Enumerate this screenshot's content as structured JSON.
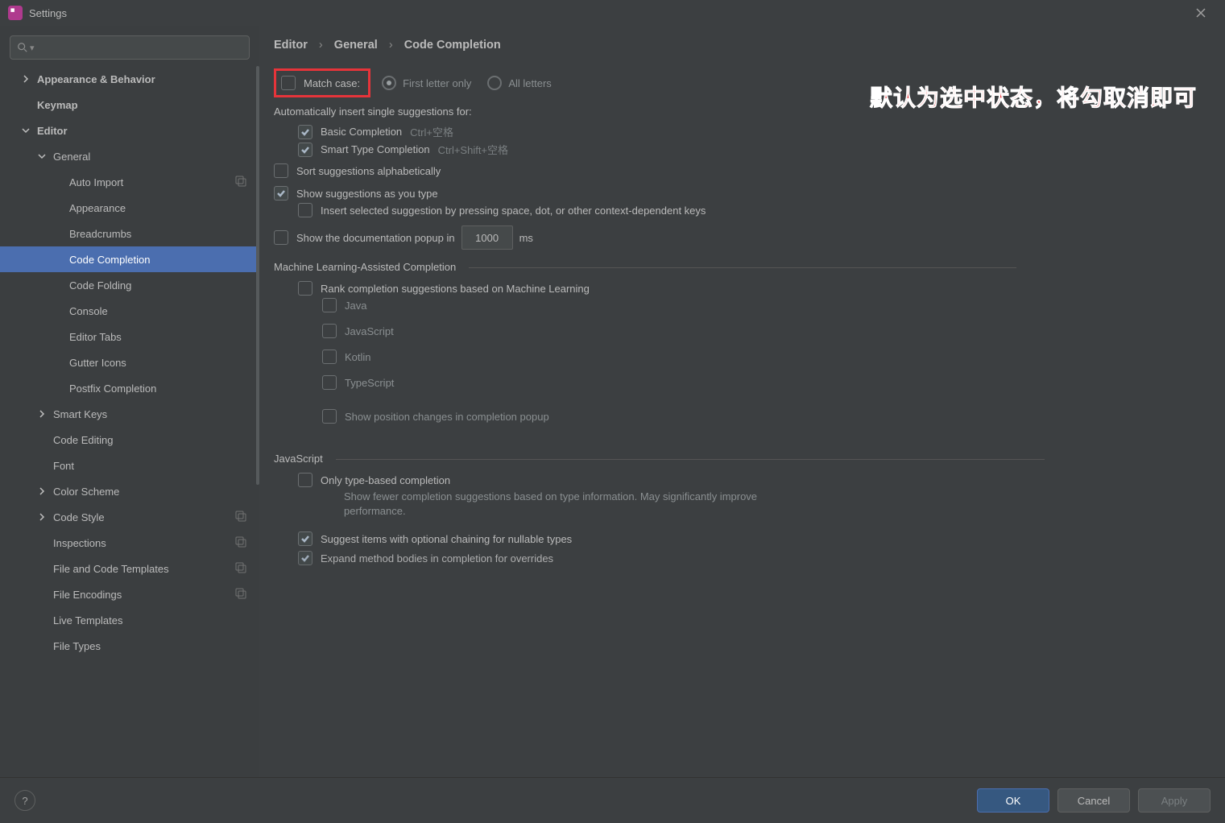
{
  "title": "Settings",
  "annotation_text": "默认为选中状态，将勾取消即可",
  "breadcrumbs": [
    "Editor",
    "General",
    "Code Completion"
  ],
  "sidebar": {
    "items": [
      {
        "label": "Appearance & Behavior",
        "indent": 0,
        "chev": "right",
        "bold": true
      },
      {
        "label": "Keymap",
        "indent": 0,
        "bold": true
      },
      {
        "label": "Editor",
        "indent": 0,
        "chev": "down",
        "bold": true
      },
      {
        "label": "General",
        "indent": 1,
        "chev": "down"
      },
      {
        "label": "Auto Import",
        "indent": 2,
        "badge": true
      },
      {
        "label": "Appearance",
        "indent": 2
      },
      {
        "label": "Breadcrumbs",
        "indent": 2
      },
      {
        "label": "Code Completion",
        "indent": 2,
        "selected": true
      },
      {
        "label": "Code Folding",
        "indent": 2
      },
      {
        "label": "Console",
        "indent": 2
      },
      {
        "label": "Editor Tabs",
        "indent": 2
      },
      {
        "label": "Gutter Icons",
        "indent": 2
      },
      {
        "label": "Postfix Completion",
        "indent": 2
      },
      {
        "label": "Smart Keys",
        "indent": 1,
        "chev": "right"
      },
      {
        "label": "Code Editing",
        "indent": 1
      },
      {
        "label": "Font",
        "indent": 1
      },
      {
        "label": "Color Scheme",
        "indent": 1,
        "chev": "right"
      },
      {
        "label": "Code Style",
        "indent": 1,
        "chev": "right",
        "badge": true
      },
      {
        "label": "Inspections",
        "indent": 1,
        "badge": true
      },
      {
        "label": "File and Code Templates",
        "indent": 1,
        "badge": true
      },
      {
        "label": "File Encodings",
        "indent": 1,
        "badge": true
      },
      {
        "label": "Live Templates",
        "indent": 1
      },
      {
        "label": "File Types",
        "indent": 1
      }
    ]
  },
  "settings": {
    "match_case": "Match case:",
    "radio_first": "First letter only",
    "radio_all": "All letters",
    "auto_insert_title": "Automatically insert single suggestions for:",
    "basic_completion": "Basic Completion",
    "basic_shortcut": "Ctrl+空格",
    "smart_completion": "Smart Type Completion",
    "smart_shortcut": "Ctrl+Shift+空格",
    "sort_alpha": "Sort suggestions alphabetically",
    "show_as_type": "Show suggestions as you type",
    "insert_selected": "Insert selected suggestion by pressing space, dot, or other context-dependent keys",
    "show_doc_prefix": "Show the documentation popup in",
    "show_doc_value": "1000",
    "show_doc_suffix": "ms",
    "ml_section": "Machine Learning-Assisted Completion",
    "ml_rank": "Rank completion suggestions based on Machine Learning",
    "ml_java": "Java",
    "ml_js": "JavaScript",
    "ml_kotlin": "Kotlin",
    "ml_ts": "TypeScript",
    "ml_show_pos": "Show position changes in completion popup",
    "js_section": "JavaScript",
    "js_only_type": "Only type-based completion",
    "js_only_type_desc": "Show fewer completion suggestions based on type information. May significantly improve performance.",
    "js_optional_chain": "Suggest items with optional chaining for nullable types",
    "js_expand_bodies": "Expand method bodies in completion for overrides"
  },
  "footer": {
    "ok": "OK",
    "cancel": "Cancel",
    "apply": "Apply"
  }
}
